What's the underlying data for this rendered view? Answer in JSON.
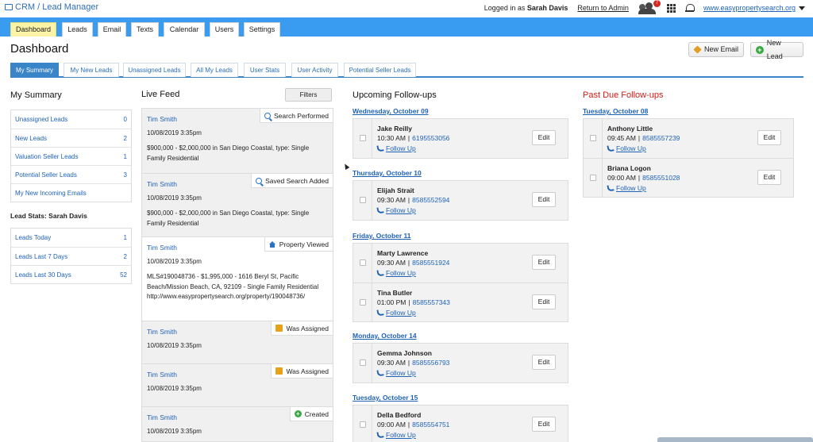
{
  "brand": {
    "title": "CRM / Lead Manager",
    "icon": "crm-icon"
  },
  "topbar": {
    "logged_in_prefix": "Logged in as",
    "user_name": "Sarah Davis",
    "return_admin": "Return to Admin",
    "notification_count": "7",
    "site": "www.easypropertysearch.org"
  },
  "nav": {
    "tabs": [
      "Dashboard",
      "Leads",
      "Email",
      "Texts",
      "Calendar",
      "Users",
      "Settings"
    ],
    "active": "Dashboard"
  },
  "page": {
    "title": "Dashboard",
    "new_email": "New Email",
    "new_lead": "New Lead"
  },
  "subtabs": {
    "items": [
      "My Summary",
      "My New Leads",
      "Unassigned Leads",
      "All My Leads",
      "User Stats",
      "User Activity",
      "Potential Seller Leads"
    ],
    "active": "My Summary"
  },
  "summary": {
    "title": "My Summary",
    "items": [
      {
        "label": "Unassigned Leads",
        "count": "0"
      },
      {
        "label": "New Leads",
        "count": "2"
      },
      {
        "label": "Valuation Seller Leads",
        "count": "1"
      },
      {
        "label": "Potential Seller Leads",
        "count": "3"
      },
      {
        "label": "My New Incoming Emails",
        "count": ""
      }
    ],
    "lead_stats_title": "Lead Stats: Sarah Davis",
    "stats": [
      {
        "label": "Leads Today",
        "count": "1"
      },
      {
        "label": "Leads Last 7 Days",
        "count": "2"
      },
      {
        "label": "Leads Last 30 Days",
        "count": "52"
      }
    ]
  },
  "feed": {
    "title": "Live Feed",
    "filters": "Filters",
    "items": [
      {
        "who": "Tim Smith",
        "when": "10/08/2019 3:35pm",
        "tag": "Search Performed",
        "icon": "search-icon",
        "desc": "$900,000 - $2,000,000 in San Diego Coastal, type: Single Family Residential"
      },
      {
        "who": "Tim Smith",
        "when": "10/08/2019 3:35pm",
        "tag": "Saved Search Added",
        "icon": "search-icon",
        "desc": "$900,000 - $2,000,000 in San Diego Coastal, type: Single Family Residential"
      },
      {
        "who": "Tim Smith",
        "when": "10/08/2019 3:35pm",
        "tag": "Property Viewed",
        "icon": "home-icon",
        "desc": "MLS#190048736 - $1,995,000 - 1616 Beryl St, Pacific Beach/Mission Beach, CA, 92109 - Single Family Residential http://www.easypropertysearch.org/property/190048736/"
      },
      {
        "who": "Tim Smith",
        "when": "10/08/2019 3:35pm",
        "tag": "Was Assigned",
        "icon": "user-icon",
        "desc": ""
      },
      {
        "who": "Tim Smith",
        "when": "10/08/2019 3:35pm",
        "tag": "Was Assigned",
        "icon": "user-icon",
        "desc": ""
      },
      {
        "who": "Tim Smith",
        "when": "10/08/2019 3:35pm",
        "tag": "Created",
        "icon": "plus-circle-icon",
        "desc": ""
      }
    ]
  },
  "upcoming": {
    "title": "Upcoming Follow-ups",
    "days": [
      {
        "date": "Wednesday, October 09",
        "items": [
          {
            "name": "Jake Reilly",
            "time": "10:30 AM",
            "phone": "6195553056"
          }
        ]
      },
      {
        "date": "Thursday, October 10",
        "items": [
          {
            "name": "Elijah Strait",
            "time": "09:30 AM",
            "phone": "8585552594"
          }
        ]
      },
      {
        "date": "Friday, October 11",
        "items": [
          {
            "name": "Marty Lawrence",
            "time": "09:30 AM",
            "phone": "8585551924"
          },
          {
            "name": "Tina Butler",
            "time": "01:00 PM",
            "phone": "8585557343"
          }
        ]
      },
      {
        "date": "Monday, October 14",
        "items": [
          {
            "name": "Gemma Johnson",
            "time": "09:30 AM",
            "phone": "8585556793"
          }
        ]
      },
      {
        "date": "Tuesday, October 15",
        "items": [
          {
            "name": "Della Bedford",
            "time": "09:00 AM",
            "phone": "8585554751"
          }
        ]
      }
    ],
    "follow_label": "Follow Up",
    "edit_label": "Edit"
  },
  "pastdue": {
    "title": "Past Due Follow-ups",
    "days": [
      {
        "date": "Tuesday, October 08",
        "items": [
          {
            "name": "Anthony Little",
            "time": "09:45 AM",
            "phone": "8585557239"
          },
          {
            "name": "Briana Logon",
            "time": "09:00 AM",
            "phone": "8585551028"
          }
        ]
      }
    ]
  },
  "colors": {
    "nav": "#3a9cf0",
    "active_tab": "#fbf3a6",
    "link": "#1e62b6",
    "past_due": "#d11c14"
  }
}
